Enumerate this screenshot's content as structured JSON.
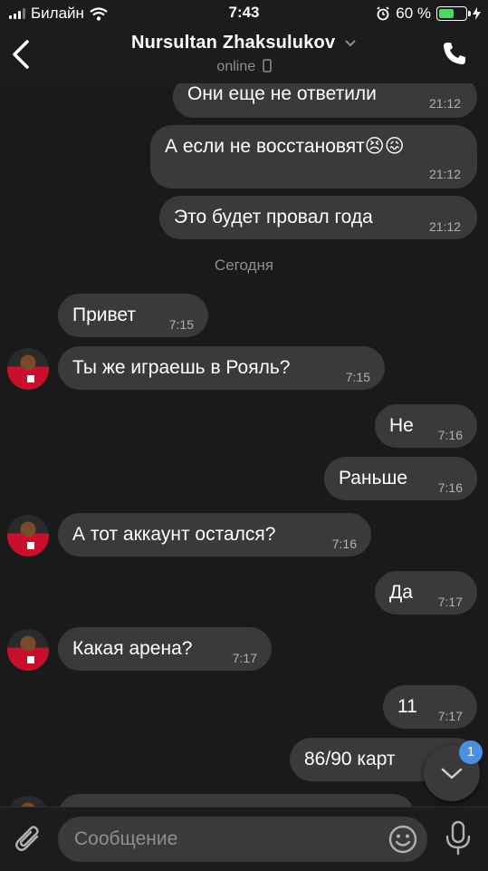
{
  "status_bar": {
    "carrier": "Билайн",
    "time": "7:43",
    "battery_percent": "60 %",
    "battery_level": 0.6
  },
  "header": {
    "contact_name": "Nursultan Zhaksulukov",
    "status": "online"
  },
  "chat": {
    "day_separator": "Сегодня",
    "messages": [
      {
        "text": "Они еще не ответили",
        "time": "21:12",
        "direction": "outgoing"
      },
      {
        "text": "А если не восстановят😣😖",
        "time": "21:12",
        "direction": "outgoing"
      },
      {
        "text": "Это будет провал года",
        "time": "21:12",
        "direction": "outgoing"
      },
      {
        "text": "Привет",
        "time": "7:15",
        "direction": "incoming"
      },
      {
        "text": "Ты же играешь в Рояль?",
        "time": "7:15",
        "direction": "incoming"
      },
      {
        "text": "Не",
        "time": "7:16",
        "direction": "outgoing"
      },
      {
        "text": "Раньше",
        "time": "7:16",
        "direction": "outgoing"
      },
      {
        "text": "А тот аккаунт остался?",
        "time": "7:16",
        "direction": "incoming"
      },
      {
        "text": "Да",
        "time": "7:17",
        "direction": "outgoing"
      },
      {
        "text": "Какая арена?",
        "time": "7:17",
        "direction": "incoming"
      },
      {
        "text": "11",
        "time": "7:17",
        "direction": "outgoing"
      },
      {
        "text": "86/90 карт",
        "time": "",
        "direction": "outgoing"
      }
    ],
    "unread_badge": "1"
  },
  "input": {
    "placeholder": "Сообщение"
  },
  "icons": {
    "back": "chevron-left-icon",
    "call": "phone-icon",
    "attach": "paperclip-icon",
    "emoji": "smile-icon",
    "voice": "microphone-icon",
    "scroll": "chevron-down-icon"
  },
  "colors": {
    "background": "#1a1a1a",
    "bubble": "#3a3a3c",
    "badge": "#4a90e2",
    "battery": "#4cd964"
  }
}
